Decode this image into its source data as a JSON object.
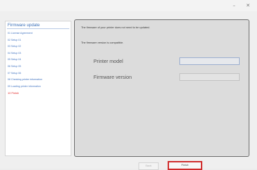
{
  "titlebar": {
    "minimize_glyph": "–",
    "close_glyph": "✕"
  },
  "sidebar": {
    "title": "Firmware update",
    "items": [
      {
        "label": "01 License Agreement"
      },
      {
        "label": "02 Setup 01"
      },
      {
        "label": "03 Setup 02"
      },
      {
        "label": "04 Setup 03"
      },
      {
        "label": "05 Setup 04"
      },
      {
        "label": "06 Setup 05"
      },
      {
        "label": "07 Setup 06"
      },
      {
        "label": "08 Checking printer information"
      },
      {
        "label": "09 Loading printer information"
      },
      {
        "label": "10 Finish"
      }
    ]
  },
  "content": {
    "message_line1": "The firmware of your printer does not need to be updated.",
    "message_line2": "The firmware version is compatible.",
    "printer_model_label": "Printer model",
    "printer_model_value": "",
    "firmware_version_label": "Firmware version",
    "firmware_version_value": ""
  },
  "footer": {
    "back_label": "Back",
    "finish_label": "Finish"
  },
  "colors": {
    "sidebar_link": "#3f72c0",
    "sidebar_active": "#e02020",
    "finish_highlight": "#cf2a2a"
  }
}
